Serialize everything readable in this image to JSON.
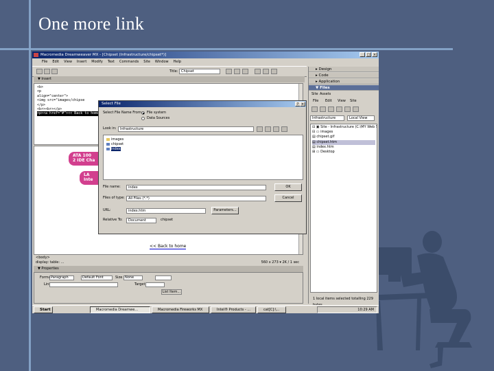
{
  "slide": {
    "title": "One more link"
  },
  "window": {
    "title": "Macromedia Dreamweaver MX - [Chipset (Infrastructure/chipset*)]",
    "menu": [
      "File",
      "Edit",
      "View",
      "Insert",
      "Modify",
      "Text",
      "Commands",
      "Site",
      "Window",
      "Help"
    ],
    "title_label": "Title:",
    "page_title": "Chipset"
  },
  "code_panel": {
    "header": "▼ Insert",
    "lines": [
      "<b>",
      "",
      "<p",
      "align=\"center\">",
      "<img src=\"images/chipse",
      "</p>",
      "<br><br></p>",
      "<p><a href=\"#\"><< Back to home"
    ]
  },
  "design": {
    "pill1": "ATA 100\n2 IDE Cha",
    "pill2": "LA\nInte",
    "back_link": "<< Back to home",
    "tag_path": "<body>",
    "status_left": "display: table: ...",
    "status_size": "560 x 273 ▾  2K / 1 sec"
  },
  "properties": {
    "header": "▼ Properties",
    "format_label": "Format",
    "format_value": "Paragraph",
    "font_value": "Default Font",
    "size_label": "Size",
    "size_value": "None",
    "link_label": "Link",
    "target_label": "Target",
    "list_item_label": "List Item..."
  },
  "right_panels": {
    "design_header": "▸ Design",
    "code_header": "▸ Code",
    "application_header": "▸ Application",
    "files_header": "▼ Files",
    "files_tabs": [
      "Site",
      "Assets"
    ],
    "files_menu": [
      "File",
      "Edit",
      "View",
      "Site"
    ],
    "site_select": "Infrastructure",
    "view_select": "Local View",
    "tree": [
      "⊟ ▣ Site - Infrastructure (C:\\MY Web S",
      "   ⊟ ▭ images",
      "         ▤ chipset.gif",
      "      ▤ chipset.htm",
      "      ▤ index.htm",
      "⊞ ▭ Desktop"
    ],
    "file_status": "1 local items selected totalling 229 bytes."
  },
  "dialog": {
    "title": "Select File",
    "select_from_label": "Select File Name From:",
    "opt_file_system": "File system",
    "opt_data_sources": "Data Sources",
    "look_in_label": "Look in:",
    "look_in_value": "Infrastructure",
    "files": [
      "images",
      "chipset",
      "index"
    ],
    "file_name_label": "File name:",
    "file_name_value": "index",
    "files_type_label": "Files of type:",
    "files_type_value": "All Files (*.*)",
    "url_label": "URL:",
    "url_value": "index.htm",
    "relative_label": "Relative To:",
    "relative_value": "Document",
    "relative_doc": "chipset",
    "ok": "OK",
    "cancel": "Cancel",
    "parameters": "Parameters..."
  },
  "taskbar": {
    "start": "Start",
    "tasks": [
      "Macromedia Dreamwe...",
      "Macromedia Fireworks MX",
      "Intel® Products - ...",
      "cat[C]:\\..."
    ],
    "clock": "10:29 AM"
  }
}
